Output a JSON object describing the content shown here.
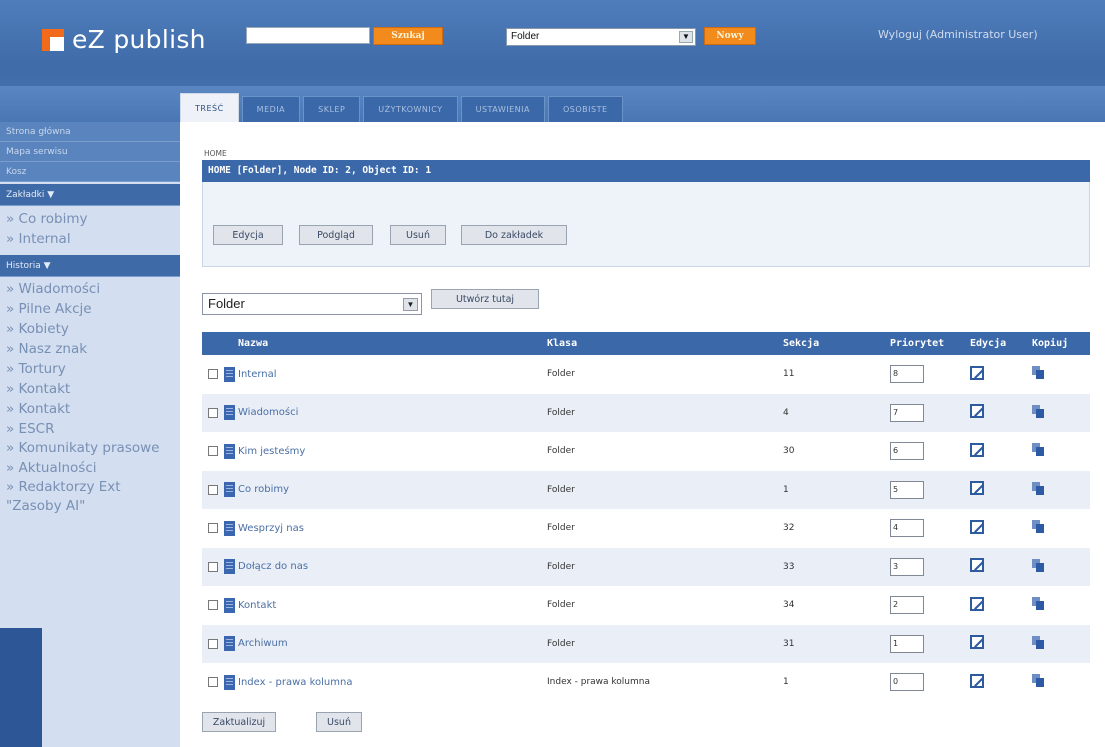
{
  "header": {
    "brand": "eZ publish",
    "search_button": "Szukaj",
    "class_select_value": "Folder",
    "new_button": "Nowy",
    "logout": "Wyloguj (Administrator User)"
  },
  "tabs": [
    {
      "label": "TREŚĆ",
      "active": true
    },
    {
      "label": "MEDIA"
    },
    {
      "label": "SKLEP"
    },
    {
      "label": "UŻYTKOWNICY"
    },
    {
      "label": "USTAWIENIA"
    },
    {
      "label": "OSOBISTE"
    }
  ],
  "sidebar": {
    "top_links": [
      "Strona główna",
      "Mapa serwisu",
      "Kosz"
    ],
    "bookmarks_title": "Zakładki ▼",
    "bookmarks": [
      "» Co robimy",
      "» Internal"
    ],
    "history_title": "Historia ▼",
    "history": [
      "» Wiadomości",
      "» Pilne Akcje",
      "» Kobiety",
      "» Nasz znak",
      "» Tortury",
      "» Kontakt",
      "» Kontakt",
      "» ESCR",
      "» Komunikaty prasowe",
      "» Aktualności",
      "» Redaktorzy Ext \"Zasoby AI\""
    ]
  },
  "main": {
    "breadcrumb": "HOME",
    "panel_title": "HOME [Folder], Node ID: 2, Object ID: 1",
    "buttons": {
      "edit": "Edycja",
      "preview": "Podgląd",
      "remove": "Usuń",
      "bookmark": "Do zakładek"
    },
    "create_select": "Folder",
    "create_button": "Utwórz tutaj",
    "columns": {
      "name": "Nazwa",
      "class": "Klasa",
      "section": "Sekcja",
      "priority": "Priorytet",
      "edit": "Edycja",
      "copy": "Kopiuj"
    },
    "rows": [
      {
        "name": "Internal",
        "class": "Folder",
        "section": "11",
        "priority": "8"
      },
      {
        "name": "Wiadomości",
        "class": "Folder",
        "section": "4",
        "priority": "7"
      },
      {
        "name": "Kim jesteśmy",
        "class": "Folder",
        "section": "30",
        "priority": "6"
      },
      {
        "name": "Co robimy",
        "class": "Folder",
        "section": "1",
        "priority": "5"
      },
      {
        "name": "Wesprzyj nas",
        "class": "Folder",
        "section": "32",
        "priority": "4"
      },
      {
        "name": "Dołącz do nas",
        "class": "Folder",
        "section": "33",
        "priority": "3"
      },
      {
        "name": "Kontakt",
        "class": "Folder",
        "section": "34",
        "priority": "2"
      },
      {
        "name": "Archiwum",
        "class": "Folder",
        "section": "31",
        "priority": "1"
      },
      {
        "name": "Index - prawa kolumna",
        "class": "Index - prawa kolumna",
        "section": "1",
        "priority": "0"
      }
    ],
    "update_button": "Zaktualizuj",
    "remove_button": "Usuń"
  },
  "colors": {
    "header": "#4a78b6",
    "accent": "#f28a1c",
    "panel": "#3b68a9",
    "sidebar": "#d3def0"
  }
}
